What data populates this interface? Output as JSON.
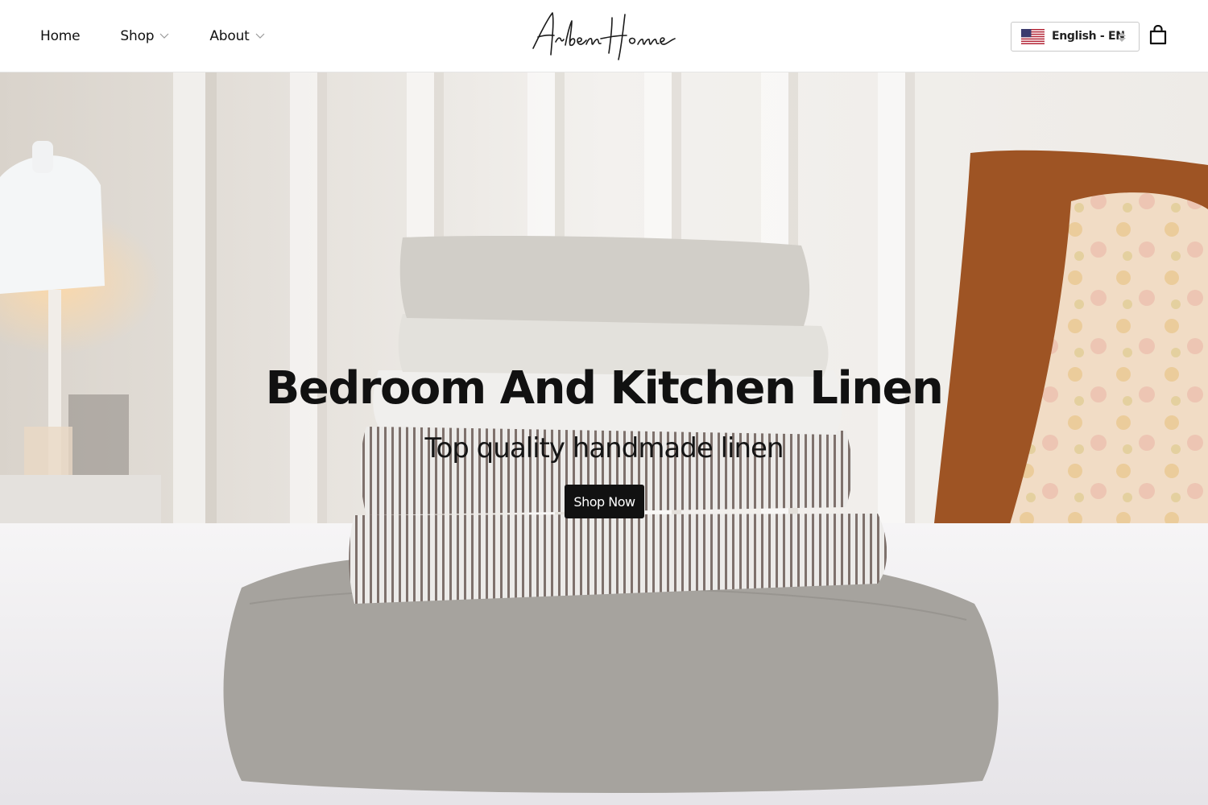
{
  "header": {
    "nav": [
      {
        "label": "Home",
        "has_dropdown": false
      },
      {
        "label": "Shop",
        "has_dropdown": true
      },
      {
        "label": "About",
        "has_dropdown": true
      }
    ],
    "logo_text": "ArbenHome",
    "language": {
      "selected": "English - EN",
      "flag": "us-flag-icon"
    },
    "cart_icon": "shopping-bag-icon"
  },
  "hero": {
    "title": "Bedroom And Kitchen Linen",
    "subtitle": "Top quality handmade linen",
    "cta_label": "Shop Now",
    "image": "stack-of-folded-linen-photo"
  },
  "colors": {
    "header_bg": "#ffffff",
    "button_bg": "#111111",
    "button_text": "#ffffff",
    "text": "#111111"
  }
}
